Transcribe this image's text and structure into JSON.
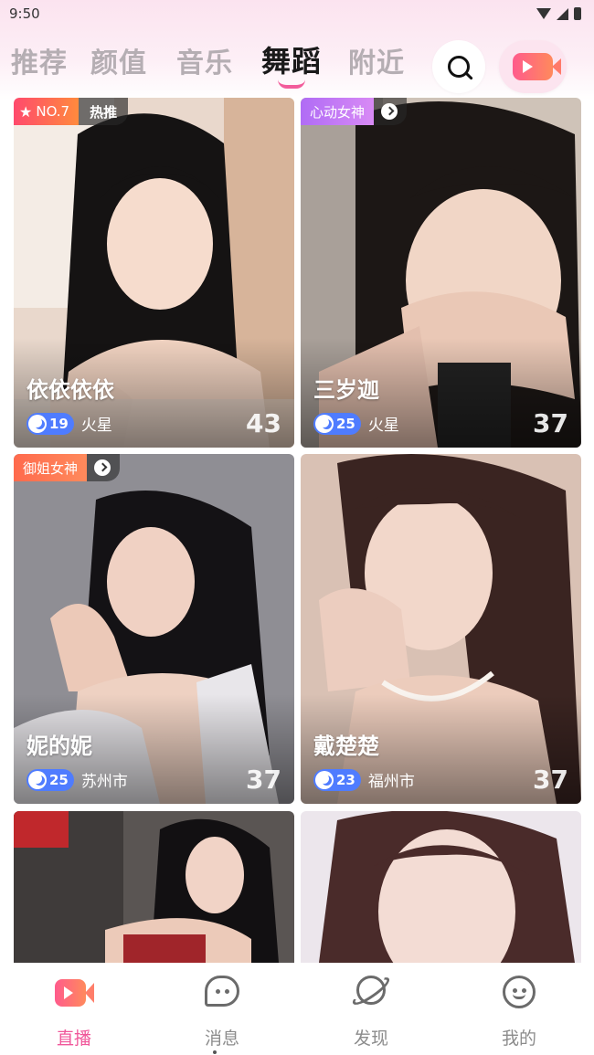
{
  "status_bar": {
    "time": "9:50"
  },
  "tabs": [
    {
      "label": "推荐",
      "active": false
    },
    {
      "label": "颜值",
      "active": false
    },
    {
      "label": "音乐",
      "active": false
    },
    {
      "label": "舞蹈",
      "active": true
    },
    {
      "label": "附近",
      "active": false
    }
  ],
  "header_icons": {
    "search": "search-icon",
    "go_live": "video-camera-icon"
  },
  "colors": {
    "accent": "#f0579a",
    "level_badge": "#4f7cff",
    "rank_badge": "#ff4a6d",
    "tag_purple": "#b06cf5"
  },
  "cards": [
    {
      "rank": "NO.7",
      "hot": "热推",
      "tag": "",
      "name": "依依依依",
      "level": "19",
      "city": "火星",
      "count": "43"
    },
    {
      "rank": "",
      "hot": "",
      "tag": "心动女神",
      "name": "三岁迦",
      "level": "25",
      "city": "火星",
      "count": "37"
    },
    {
      "rank": "",
      "hot": "",
      "tag": "御姐女神",
      "name": "妮的妮",
      "level": "25",
      "city": "苏州市",
      "count": "37"
    },
    {
      "rank": "",
      "hot": "",
      "tag": "",
      "name": "戴楚楚",
      "level": "23",
      "city": "福州市",
      "count": "37"
    }
  ],
  "bottom_nav": [
    {
      "label": "直播",
      "icon": "live-video-icon",
      "active": true
    },
    {
      "label": "消息",
      "icon": "message-bubble-icon",
      "active": false
    },
    {
      "label": "发现",
      "icon": "planet-icon",
      "active": false
    },
    {
      "label": "我的",
      "icon": "profile-face-icon",
      "active": false
    }
  ]
}
